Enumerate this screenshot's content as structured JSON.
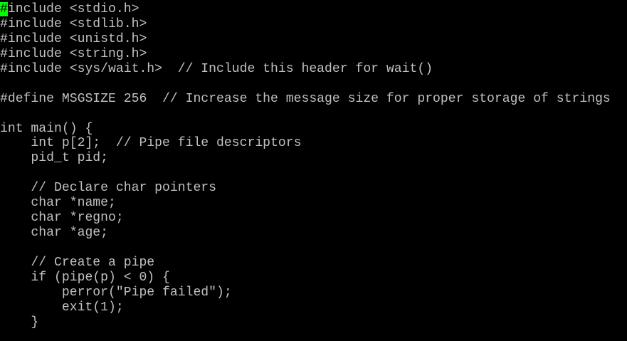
{
  "editor": {
    "cursor_char": "#",
    "cursor_color": "#00ff00",
    "text_color": "#c0c0c0",
    "background_color": "#000000",
    "lines": [
      "include <stdio.h>",
      "#include <stdlib.h>",
      "#include <unistd.h>",
      "#include <string.h>",
      "#include <sys/wait.h>  // Include this header for wait()",
      "",
      "#define MSGSIZE 256  // Increase the message size for proper storage of strings",
      "",
      "int main() {",
      "    int p[2];  // Pipe file descriptors",
      "    pid_t pid;",
      "",
      "    // Declare char pointers",
      "    char *name;",
      "    char *regno;",
      "    char *age;",
      "",
      "    // Create a pipe",
      "    if (pipe(p) < 0) {",
      "        perror(\"Pipe failed\");",
      "        exit(1);",
      "    }"
    ]
  }
}
